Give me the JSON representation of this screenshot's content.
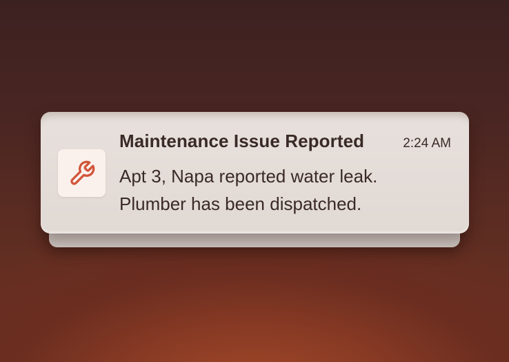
{
  "notification": {
    "title": "Maintenance Issue Reported",
    "time": "2:24 AM",
    "message_lines": [
      "Apt 3, Napa reported water leak.",
      "Plumber has been dispatched."
    ],
    "icon": "wrench-icon"
  },
  "colors": {
    "icon_accent": "#d2553b",
    "icon_background": "#fbf1ec",
    "card_background": "#e4dcd7",
    "text": "#3a2a27"
  }
}
